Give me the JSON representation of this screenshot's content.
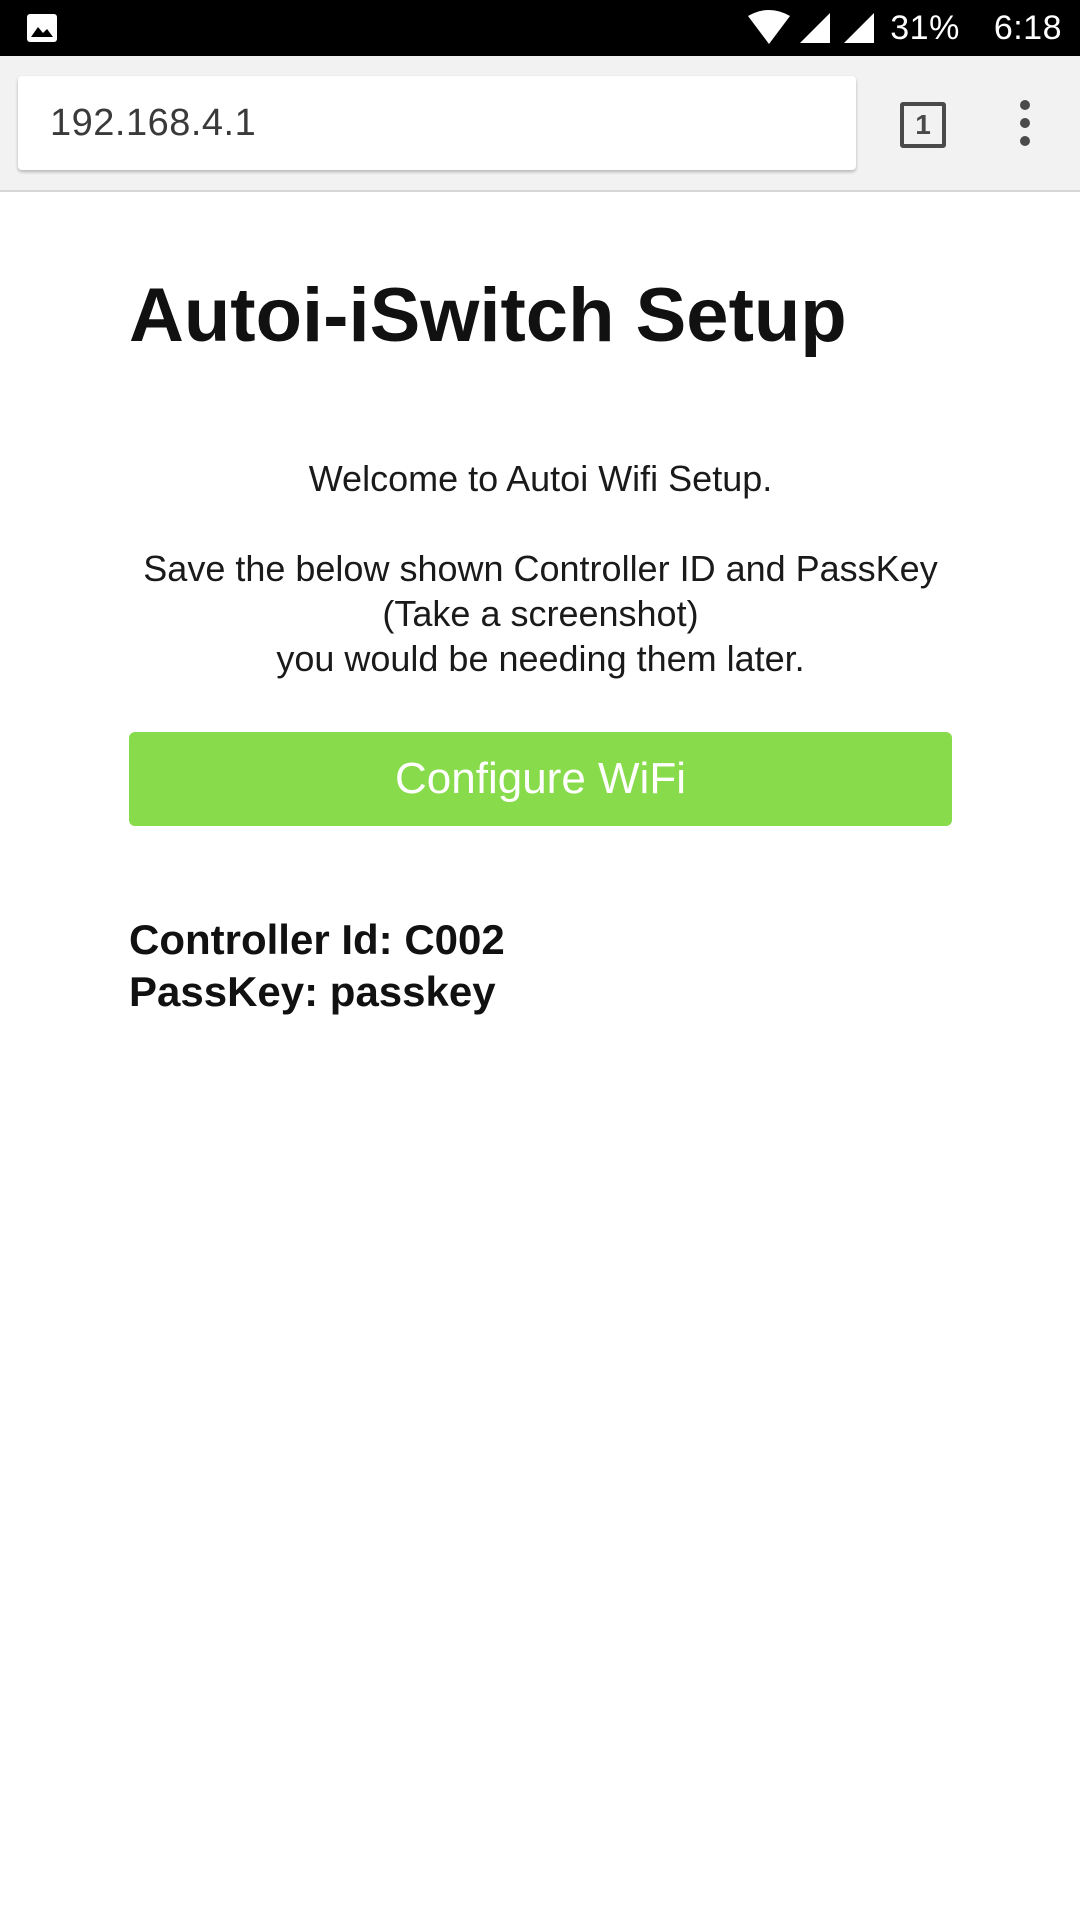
{
  "status_bar": {
    "notification_icon": "image-icon",
    "wifi_icon": "wifi-icon",
    "signal_icon": "cell-signal-icon",
    "battery": "31%",
    "time": "6:18"
  },
  "browser": {
    "url": "192.168.4.1",
    "tab_count": "1",
    "menu_icon": "more-vert-icon"
  },
  "page": {
    "title": "Autoi-iSwitch Setup",
    "welcome": "Welcome to Autoi Wifi Setup.",
    "instruction_lines": [
      "Save the below shown Controller ID and PassKey",
      "(Take a screenshot)",
      "you would be needing them later."
    ],
    "configure_button": "Configure WiFi",
    "controller_id": "Controller Id: C002",
    "passkey": "PassKey: passkey"
  },
  "colors": {
    "button": "#88db4b",
    "status_bar": "#000000",
    "toolbar": "#f2f2f2"
  }
}
